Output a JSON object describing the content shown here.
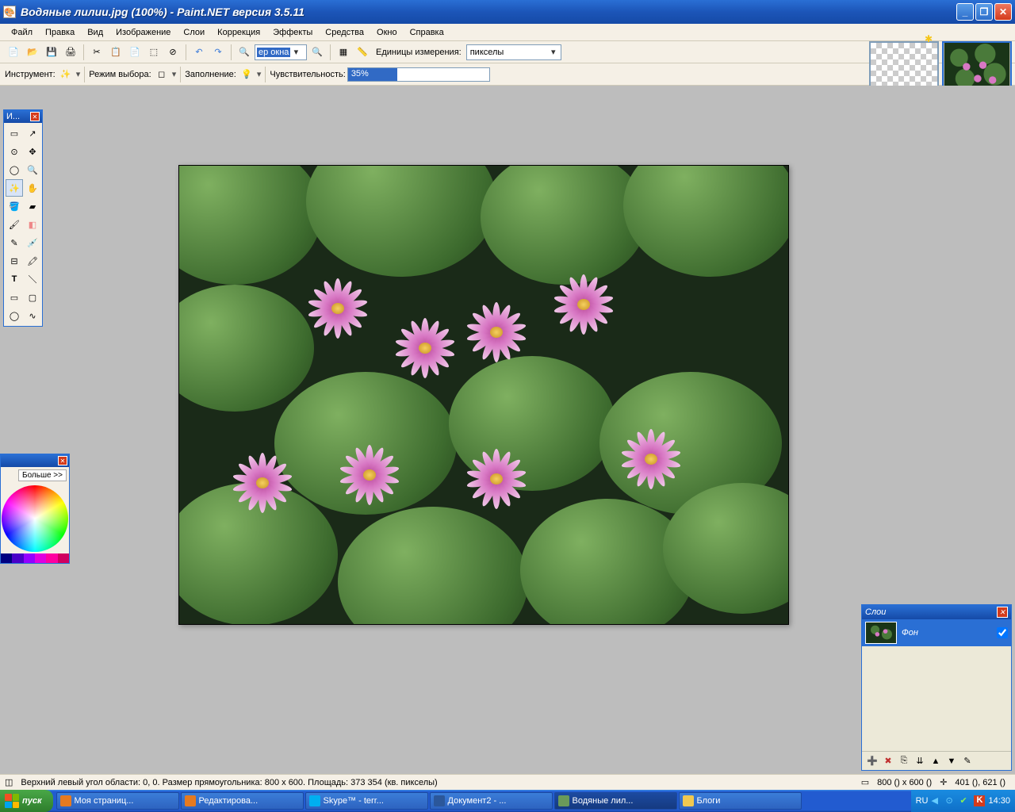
{
  "title": "Водяные лилии.jpg (100%) - Paint.NET версия 3.5.11",
  "menu": [
    "Файл",
    "Правка",
    "Вид",
    "Изображение",
    "Слои",
    "Коррекция",
    "Эффекты",
    "Средства",
    "Окно",
    "Справка"
  ],
  "toolbar1": {
    "zoom_combo": "ер окна",
    "units_label": "Единицы измерения:",
    "units_value": "пикселы"
  },
  "toolbar2": {
    "tool_label": "Инструмент:",
    "mode_label": "Режим выбора:",
    "fill_label": "Заполнение:",
    "tolerance_label": "Чувствительность:",
    "tolerance_value": "35%",
    "tolerance_percent": 35
  },
  "tools_palette": {
    "title": "И..."
  },
  "colors_palette": {
    "more": "Больше >>"
  },
  "layers_palette": {
    "title": "Слои",
    "layer_name": "Фон",
    "layer_visible": true
  },
  "status": {
    "selection": "Верхний левый угол области: 0, 0. Размер прямоугольника: 800 x 600. Площадь: 373 354 (кв. пикселы)",
    "canvas_size": "800 () x 600 ()",
    "cursor": "401 (), 621 ()"
  },
  "taskbar": {
    "start": "пуск",
    "tasks": [
      "Моя страниц...",
      "Редактирова...",
      "Skype™ - terr...",
      "Документ2 - ...",
      "Водяные лил...",
      "Блоги"
    ],
    "lang": "RU",
    "clock": "14:30"
  },
  "swatches": [
    "#000080",
    "#4a00c8",
    "#9500ff",
    "#e000e0",
    "#ff00a0",
    "#d00060"
  ]
}
